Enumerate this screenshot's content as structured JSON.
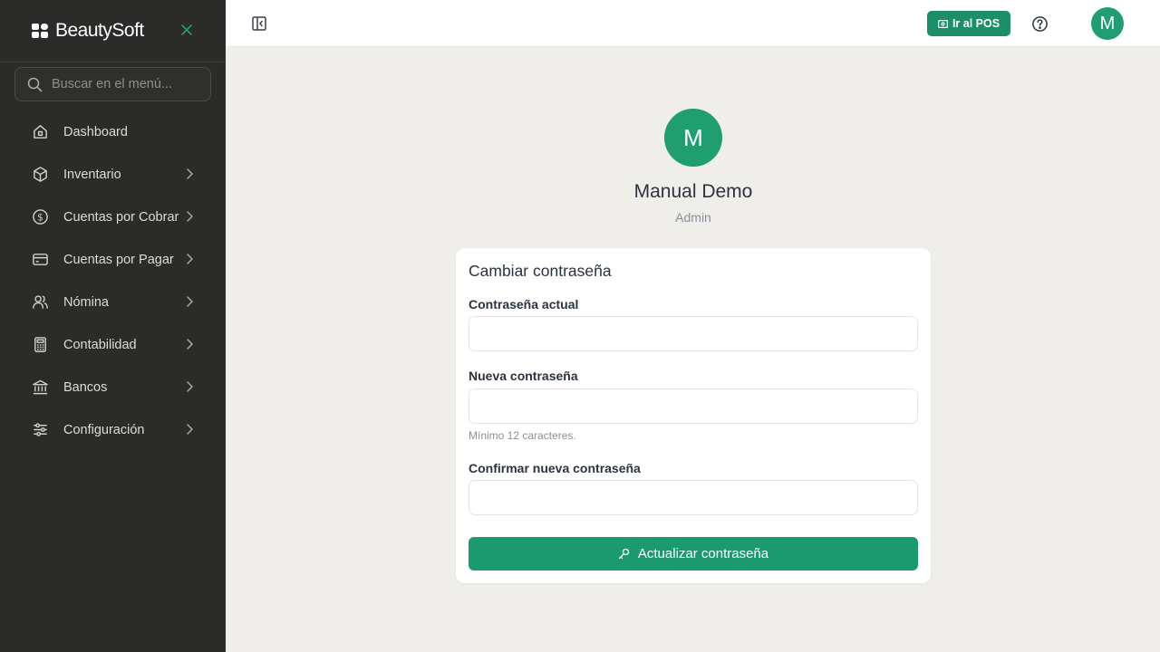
{
  "brand": {
    "name": "BeautySoft",
    "accent": "#1f9e72"
  },
  "sidebar": {
    "search_placeholder": "Buscar en el menú...",
    "items": [
      {
        "label": "Dashboard",
        "icon": "home-icon",
        "has_children": false
      },
      {
        "label": "Inventario",
        "icon": "box-icon",
        "has_children": true
      },
      {
        "label": "Cuentas por Cobrar",
        "icon": "dollar-circle-icon",
        "has_children": true
      },
      {
        "label": "Cuentas por Pagar",
        "icon": "credit-card-icon",
        "has_children": true
      },
      {
        "label": "Nómina",
        "icon": "users-icon",
        "has_children": true
      },
      {
        "label": "Contabilidad",
        "icon": "calculator-icon",
        "has_children": true
      },
      {
        "label": "Bancos",
        "icon": "bank-icon",
        "has_children": true
      },
      {
        "label": "Configuración",
        "icon": "sliders-icon",
        "has_children": true
      }
    ]
  },
  "topbar": {
    "pos_button": "Ir al POS",
    "avatar_initial": "M"
  },
  "profile": {
    "avatar_initial": "M",
    "name": "Manual Demo",
    "role": "Admin"
  },
  "password_form": {
    "title": "Cambiar contraseña",
    "current_label": "Contraseña actual",
    "current_value": "",
    "new_label": "Nueva contraseña",
    "new_value": "",
    "new_hint": "Mínimo 12 caracteres.",
    "confirm_label": "Confirmar nueva contraseña",
    "confirm_value": "",
    "submit_label": "Actualizar contraseña"
  }
}
